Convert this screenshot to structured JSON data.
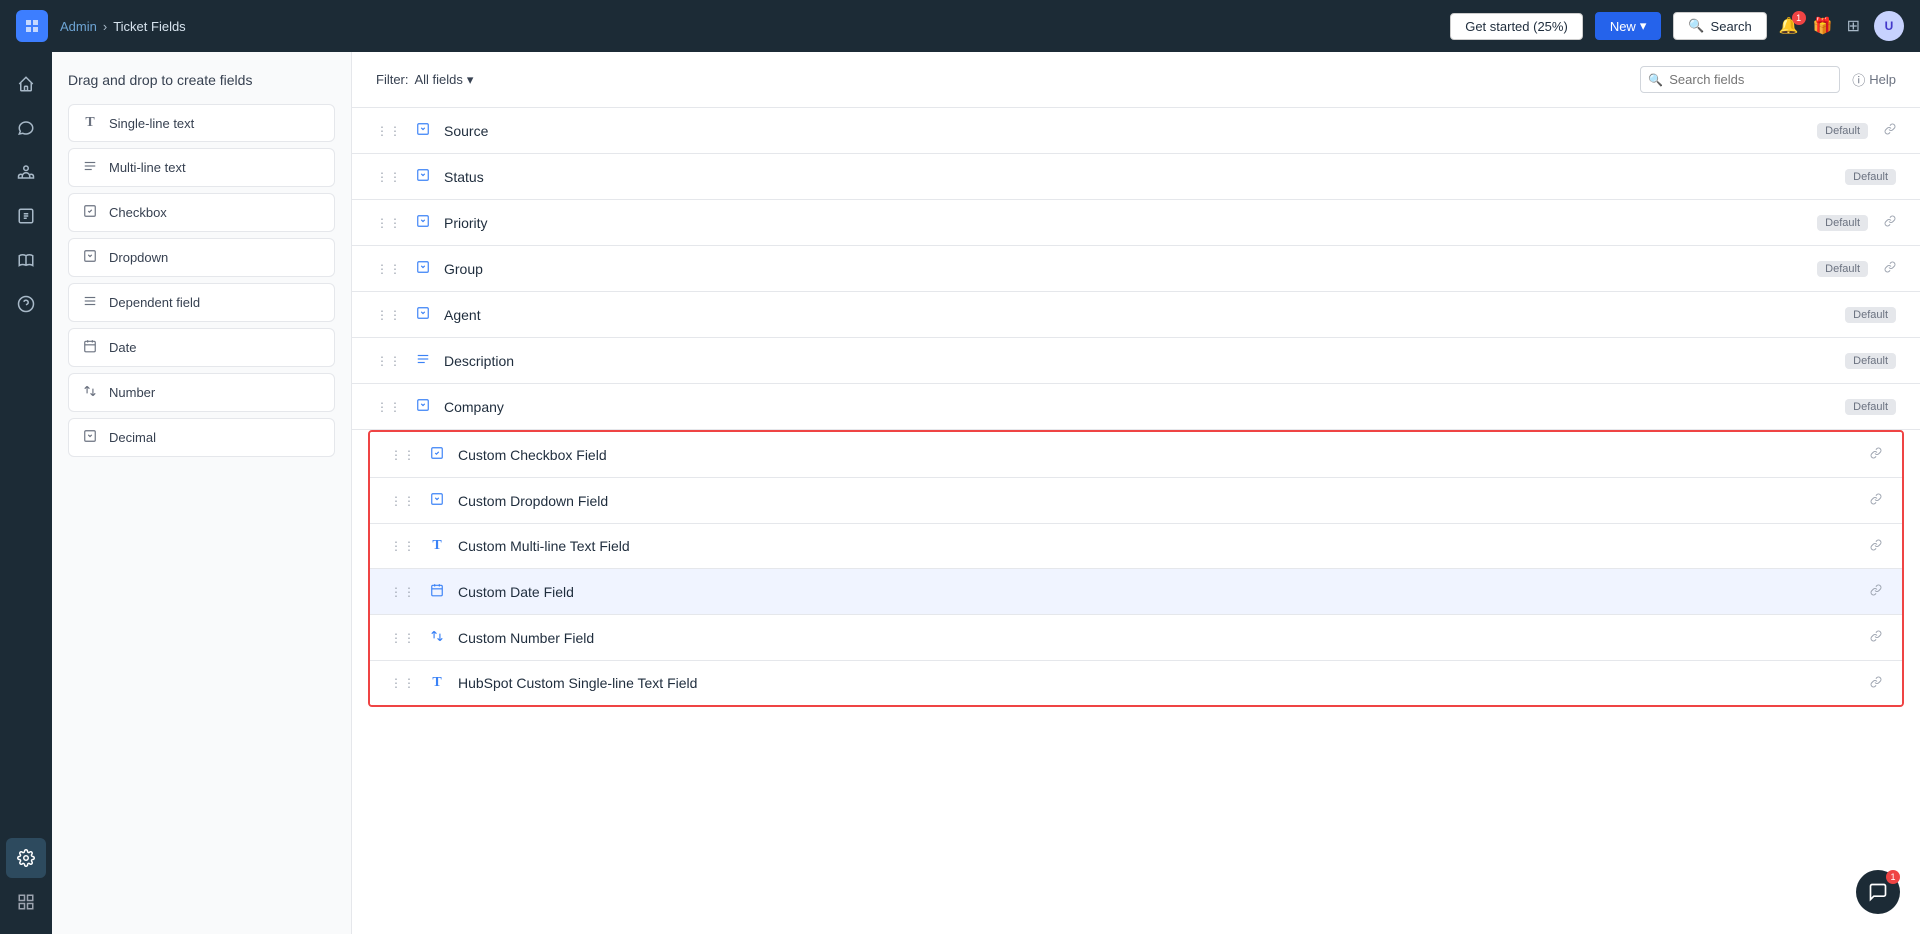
{
  "topNav": {
    "logo": "FW",
    "breadcrumb": {
      "parent": "Admin",
      "separator": "›",
      "current": "Ticket Fields"
    },
    "getStarted": "Get started (25%)",
    "new": "New",
    "search": "Search",
    "notificationBadge": "1",
    "avatar": "U"
  },
  "panelSidebar": {
    "title": "Drag and drop to create fields",
    "fieldTypes": [
      {
        "id": "single-line-text",
        "label": "Single-line text",
        "icon": "T"
      },
      {
        "id": "multi-line-text",
        "label": "Multi-line text",
        "icon": "≡"
      },
      {
        "id": "checkbox",
        "label": "Checkbox",
        "icon": "☑"
      },
      {
        "id": "dropdown",
        "label": "Dropdown",
        "icon": "⊡"
      },
      {
        "id": "dependent-field",
        "label": "Dependent field",
        "icon": "≡"
      },
      {
        "id": "date",
        "label": "Date",
        "icon": "▦"
      },
      {
        "id": "number",
        "label": "Number",
        "icon": "⇄"
      },
      {
        "id": "decimal",
        "label": "Decimal",
        "icon": "⊡"
      }
    ]
  },
  "filterBar": {
    "filterLabel": "Filter:",
    "filterValue": "All fields",
    "searchPlaceholder": "Search fields",
    "helpLabel": "Help"
  },
  "defaultFields": [
    {
      "id": "source",
      "name": "Source",
      "badge": "Default",
      "hasLink": true
    },
    {
      "id": "status",
      "name": "Status",
      "badge": "Default",
      "hasLink": false
    },
    {
      "id": "priority",
      "name": "Priority",
      "badge": "Default",
      "hasLink": true
    },
    {
      "id": "group",
      "name": "Group",
      "badge": "Default",
      "hasLink": true
    },
    {
      "id": "agent",
      "name": "Agent",
      "badge": "Default",
      "hasLink": false
    },
    {
      "id": "description",
      "name": "Description",
      "badge": "Default",
      "hasLink": false
    },
    {
      "id": "company",
      "name": "Company",
      "badge": "Default",
      "hasLink": false
    }
  ],
  "customFields": [
    {
      "id": "custom-checkbox",
      "name": "Custom Checkbox Field",
      "icon": "☑",
      "hasLink": true
    },
    {
      "id": "custom-dropdown",
      "name": "Custom Dropdown Field",
      "icon": "⊡",
      "hasLink": true
    },
    {
      "id": "custom-multiline",
      "name": "Custom Multi-line Text Field",
      "icon": "T",
      "hasLink": true
    },
    {
      "id": "custom-date",
      "name": "Custom Date Field",
      "icon": "▦",
      "hasLink": true
    },
    {
      "id": "custom-number",
      "name": "Custom Number Field",
      "icon": "⇄",
      "hasLink": true
    },
    {
      "id": "hubspot-single",
      "name": "HubSpot Custom Single-line Text Field",
      "icon": "T",
      "hasLink": true
    }
  ],
  "sidebarIcons": [
    {
      "id": "home",
      "symbol": "⌂"
    },
    {
      "id": "chat",
      "symbol": "💬"
    },
    {
      "id": "contacts",
      "symbol": "👤"
    },
    {
      "id": "reports",
      "symbol": "📊"
    },
    {
      "id": "solutions",
      "symbol": "📖"
    },
    {
      "id": "help",
      "symbol": "❓"
    },
    {
      "id": "settings",
      "symbol": "⚙"
    }
  ],
  "chatBubble": {
    "badge": "1"
  }
}
